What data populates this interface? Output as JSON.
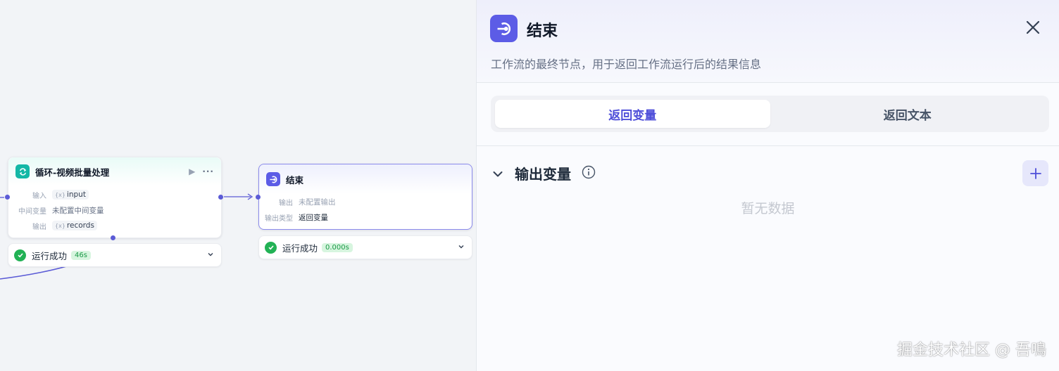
{
  "loop_node": {
    "title": "循环-视频批量处理",
    "rows": [
      {
        "label": "输入",
        "value": "input"
      },
      {
        "label": "中间变量",
        "value": "未配置中间变量"
      },
      {
        "label": "输出",
        "value": "records"
      }
    ],
    "status": {
      "text": "运行成功",
      "time": "46s"
    },
    "icon": "loop-icon",
    "color": "#14b8a6"
  },
  "end_node": {
    "title": "结束",
    "rows": [
      {
        "label": "输出",
        "value": "未配置输出"
      },
      {
        "label": "输出类型",
        "value": "返回变量"
      }
    ],
    "status": {
      "text": "运行成功",
      "time": "0.000s"
    },
    "icon": "end-icon",
    "color": "#5c5ce6"
  },
  "panel": {
    "title": "结束",
    "description": "工作流的最终节点，用于返回工作流运行后的结果信息",
    "tabs": [
      {
        "label": "返回变量",
        "active": true
      },
      {
        "label": "返回文本",
        "active": false
      }
    ],
    "section": {
      "title": "输出变量",
      "empty_text": "暂无数据"
    }
  },
  "watermark": "掘金技术社区 @ 吾鳴"
}
